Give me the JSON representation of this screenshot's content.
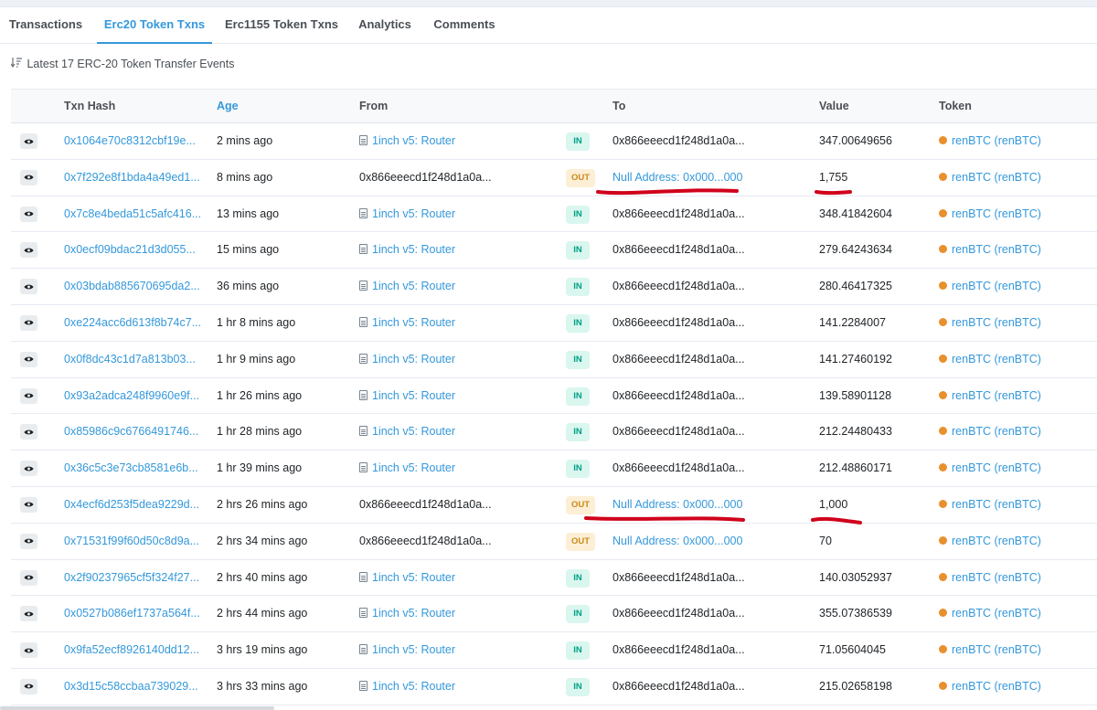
{
  "tabs": [
    {
      "label": "Transactions",
      "active": false
    },
    {
      "label": "Erc20 Token Txns",
      "active": true
    },
    {
      "label": "Erc1155 Token Txns",
      "active": false
    },
    {
      "label": "Analytics",
      "active": false
    },
    {
      "label": "Comments",
      "active": false
    }
  ],
  "summary": "Latest 17 ERC-20 Token Transfer Events",
  "columns": {
    "txn_hash": "Txn Hash",
    "age": "Age",
    "from": "From",
    "to": "To",
    "value": "Value",
    "token": "Token"
  },
  "rows": [
    {
      "hash": "0x1064e70c8312cbf19e...",
      "age": "2 mins ago",
      "from": "1inch v5: Router",
      "from_is_contract": true,
      "dir": "IN",
      "to": "0x866eeecd1f248d1a0a...",
      "to_is_link": false,
      "value": "347.00649656",
      "token": "renBTC (renBTC)"
    },
    {
      "hash": "0x7f292e8f1bda4a49ed1...",
      "age": "8 mins ago",
      "from": "0x866eeecd1f248d1a0a...",
      "from_is_contract": false,
      "dir": "OUT",
      "to": "Null Address: 0x000...000",
      "to_is_link": true,
      "value": "1,755",
      "token": "renBTC (renBTC)"
    },
    {
      "hash": "0x7c8e4beda51c5afc416...",
      "age": "13 mins ago",
      "from": "1inch v5: Router",
      "from_is_contract": true,
      "dir": "IN",
      "to": "0x866eeecd1f248d1a0a...",
      "to_is_link": false,
      "value": "348.41842604",
      "token": "renBTC (renBTC)"
    },
    {
      "hash": "0x0ecf09bdac21d3d055...",
      "age": "15 mins ago",
      "from": "1inch v5: Router",
      "from_is_contract": true,
      "dir": "IN",
      "to": "0x866eeecd1f248d1a0a...",
      "to_is_link": false,
      "value": "279.64243634",
      "token": "renBTC (renBTC)"
    },
    {
      "hash": "0x03bdab885670695da2...",
      "age": "36 mins ago",
      "from": "1inch v5: Router",
      "from_is_contract": true,
      "dir": "IN",
      "to": "0x866eeecd1f248d1a0a...",
      "to_is_link": false,
      "value": "280.46417325",
      "token": "renBTC (renBTC)"
    },
    {
      "hash": "0xe224acc6d613f8b74c7...",
      "age": "1 hr 8 mins ago",
      "from": "1inch v5: Router",
      "from_is_contract": true,
      "dir": "IN",
      "to": "0x866eeecd1f248d1a0a...",
      "to_is_link": false,
      "value": "141.2284007",
      "token": "renBTC (renBTC)"
    },
    {
      "hash": "0x0f8dc43c1d7a813b03...",
      "age": "1 hr 9 mins ago",
      "from": "1inch v5: Router",
      "from_is_contract": true,
      "dir": "IN",
      "to": "0x866eeecd1f248d1a0a...",
      "to_is_link": false,
      "value": "141.27460192",
      "token": "renBTC (renBTC)"
    },
    {
      "hash": "0x93a2adca248f9960e9f...",
      "age": "1 hr 26 mins ago",
      "from": "1inch v5: Router",
      "from_is_contract": true,
      "dir": "IN",
      "to": "0x866eeecd1f248d1a0a...",
      "to_is_link": false,
      "value": "139.58901128",
      "token": "renBTC (renBTC)"
    },
    {
      "hash": "0x85986c9c6766491746...",
      "age": "1 hr 28 mins ago",
      "from": "1inch v5: Router",
      "from_is_contract": true,
      "dir": "IN",
      "to": "0x866eeecd1f248d1a0a...",
      "to_is_link": false,
      "value": "212.24480433",
      "token": "renBTC (renBTC)"
    },
    {
      "hash": "0x36c5c3e73cb8581e6b...",
      "age": "1 hr 39 mins ago",
      "from": "1inch v5: Router",
      "from_is_contract": true,
      "dir": "IN",
      "to": "0x866eeecd1f248d1a0a...",
      "to_is_link": false,
      "value": "212.48860171",
      "token": "renBTC (renBTC)"
    },
    {
      "hash": "0x4ecf6d253f5dea9229d...",
      "age": "2 hrs 26 mins ago",
      "from": "0x866eeecd1f248d1a0a...",
      "from_is_contract": false,
      "dir": "OUT",
      "to": "Null Address: 0x000...000",
      "to_is_link": true,
      "value": "1,000",
      "token": "renBTC (renBTC)"
    },
    {
      "hash": "0x71531f99f60d50c8d9a...",
      "age": "2 hrs 34 mins ago",
      "from": "0x866eeecd1f248d1a0a...",
      "from_is_contract": false,
      "dir": "OUT",
      "to": "Null Address: 0x000...000",
      "to_is_link": true,
      "value": "70",
      "token": "renBTC (renBTC)"
    },
    {
      "hash": "0x2f90237965cf5f324f27...",
      "age": "2 hrs 40 mins ago",
      "from": "1inch v5: Router",
      "from_is_contract": true,
      "dir": "IN",
      "to": "0x866eeecd1f248d1a0a...",
      "to_is_link": false,
      "value": "140.03052937",
      "token": "renBTC (renBTC)"
    },
    {
      "hash": "0x0527b086ef1737a564f...",
      "age": "2 hrs 44 mins ago",
      "from": "1inch v5: Router",
      "from_is_contract": true,
      "dir": "IN",
      "to": "0x866eeecd1f248d1a0a...",
      "to_is_link": false,
      "value": "355.07386539",
      "token": "renBTC (renBTC)"
    },
    {
      "hash": "0x9fa52ecf8926140dd12...",
      "age": "3 hrs 19 mins ago",
      "from": "1inch v5: Router",
      "from_is_contract": true,
      "dir": "IN",
      "to": "0x866eeecd1f248d1a0a...",
      "to_is_link": false,
      "value": "71.05604045",
      "token": "renBTC (renBTC)"
    },
    {
      "hash": "0x3d15c58ccbaa739029...",
      "age": "3 hrs 33 mins ago",
      "from": "1inch v5: Router",
      "from_is_contract": true,
      "dir": "IN",
      "to": "0x866eeecd1f248d1a0a...",
      "to_is_link": false,
      "value": "215.02658198",
      "token": "renBTC (renBTC)"
    }
  ],
  "colors": {
    "link": "#3498db",
    "in_badge_bg": "#d9f6ef",
    "in_badge_text": "#00a186",
    "out_badge_bg": "#fdefd6",
    "out_badge_text": "#c98a1a",
    "annotation": "#d0021b"
  },
  "icons": {
    "sort": "sort-descending-icon",
    "row_preview": "eye-icon",
    "contract": "file-text-icon",
    "token": "renbtc-token-icon"
  }
}
